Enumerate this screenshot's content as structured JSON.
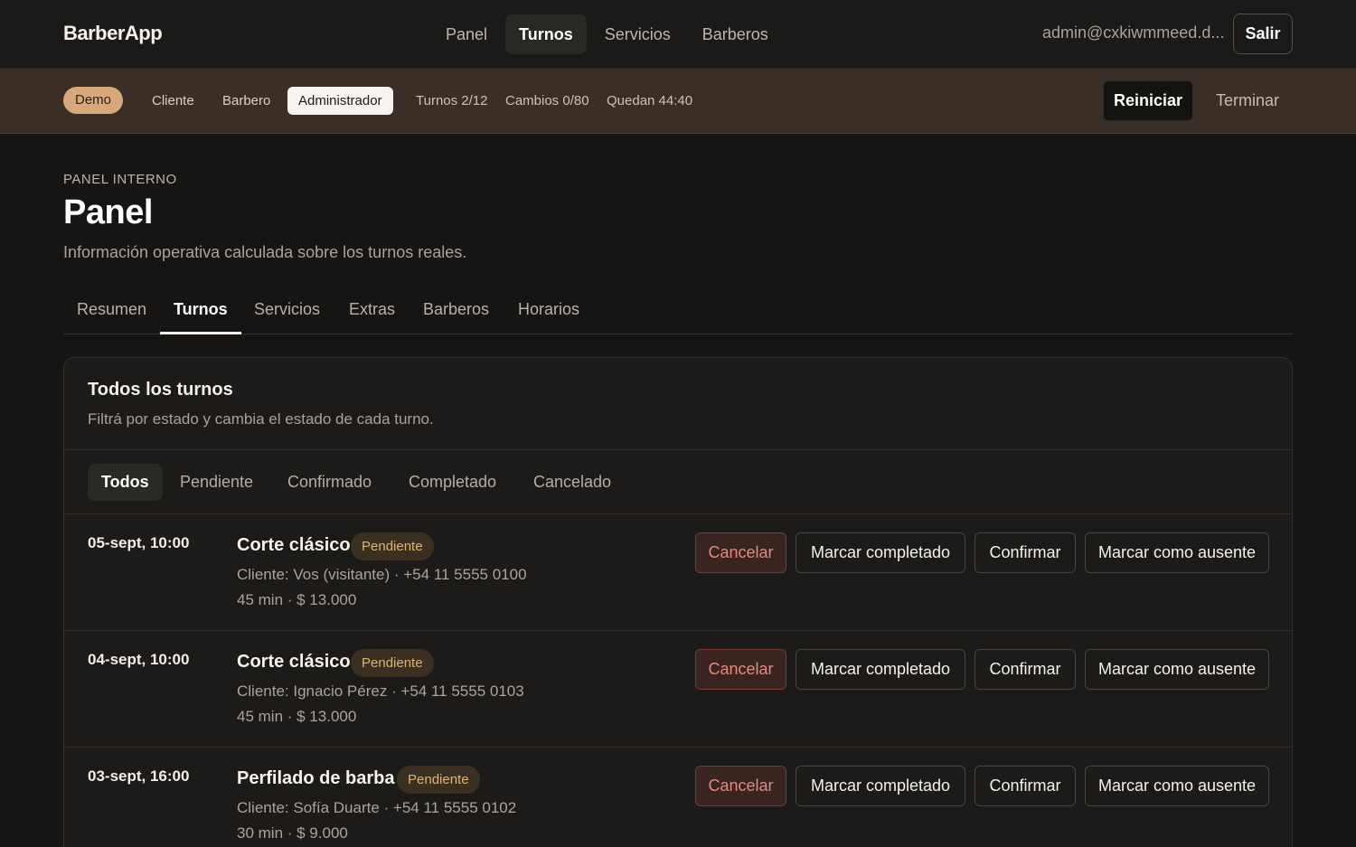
{
  "app": {
    "brand": "BarberApp"
  },
  "nav": {
    "items": [
      {
        "label": "Panel",
        "active": false
      },
      {
        "label": "Turnos",
        "active": true
      },
      {
        "label": "Servicios",
        "active": false
      },
      {
        "label": "Barberos",
        "active": false
      }
    ],
    "user_email": "admin@cxkiwmmeed.d...",
    "logout_label": "Salir"
  },
  "demo": {
    "badge": "Demo",
    "roles": [
      "Cliente",
      "Barbero",
      "Administrador"
    ],
    "active_role": "Administrador",
    "turnos": "Turnos 2/12",
    "cambios": "Cambios 0/80",
    "quedan": "Quedan 44:40",
    "reset_label": "Reiniciar",
    "end_label": "Terminar"
  },
  "header": {
    "eyebrow": "PANEL INTERNO",
    "title": "Panel",
    "subtitle": "Información operativa calculada sobre los turnos reales."
  },
  "tabs": [
    "Resumen",
    "Turnos",
    "Servicios",
    "Extras",
    "Barberos",
    "Horarios"
  ],
  "active_tab": "Turnos",
  "card": {
    "title": "Todos los turnos",
    "subtitle": "Filtrá por estado y cambia el estado de cada turno.",
    "filters": [
      "Todos",
      "Pendiente",
      "Confirmado",
      "Completado",
      "Cancelado"
    ],
    "active_filter": "Todos",
    "actions": {
      "cancel": "Cancelar",
      "complete": "Marcar completado",
      "confirm": "Confirmar",
      "absent": "Marcar como ausente"
    },
    "rows": [
      {
        "date": "05-sept, 10:00",
        "service": "Corte clásico",
        "status": "Pendiente",
        "client": "Cliente: Vos (visitante) · +54 11 5555 0100",
        "price": "45 min · $ 13.000"
      },
      {
        "date": "04-sept, 10:00",
        "service": "Corte clásico",
        "status": "Pendiente",
        "client": "Cliente: Ignacio Pérez · +54 11 5555 0103",
        "price": "45 min · $ 13.000"
      },
      {
        "date": "03-sept, 16:00",
        "service": "Perfilado de barba",
        "status": "Pendiente",
        "client": "Cliente: Sofía Duarte · +54 11 5555 0102",
        "price": "30 min · $ 9.000"
      }
    ]
  },
  "colors": {
    "background": "#161513",
    "demo_bar": "#3a2f27",
    "demo_badge": "#d9a87a",
    "pending_badge_text": "#e0b46d",
    "cancel_text": "#e28a80"
  }
}
